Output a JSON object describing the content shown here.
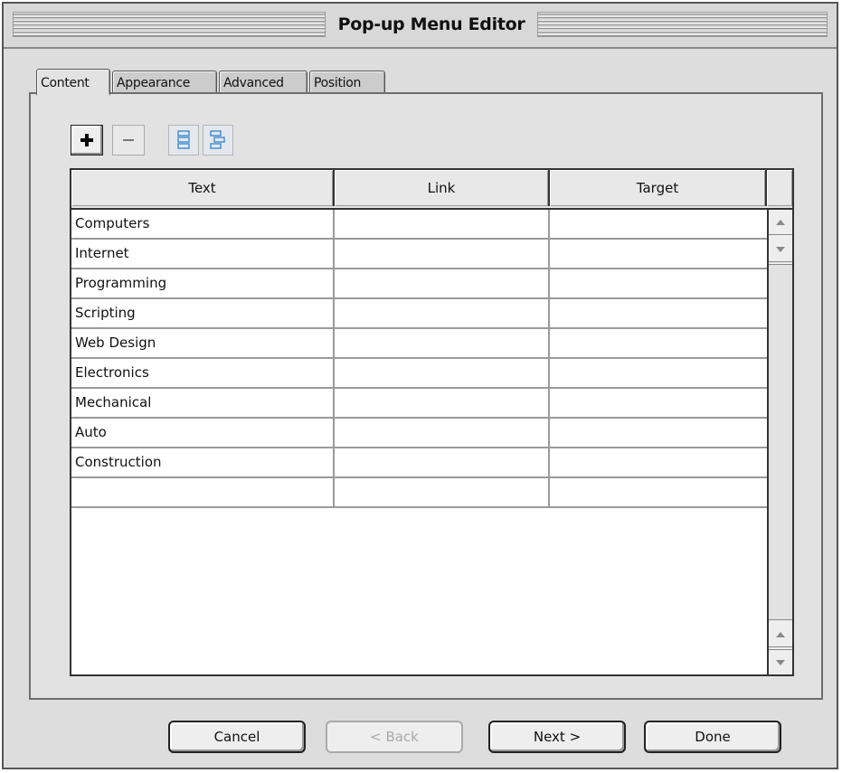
{
  "window": {
    "title": "Pop-up Menu Editor"
  },
  "tabs": [
    {
      "label": "Content",
      "active": true
    },
    {
      "label": "Appearance",
      "active": false
    },
    {
      "label": "Advanced",
      "active": false
    },
    {
      "label": "Position",
      "active": false
    }
  ],
  "toolbar": {
    "add_icon": "plus-icon",
    "remove_icon": "minus-icon",
    "move_up_icon": "move-up-icon",
    "move_down_icon": "move-down-icon"
  },
  "table": {
    "columns": [
      "Text",
      "Link",
      "Target"
    ],
    "rows": [
      [
        "Computers",
        "",
        ""
      ],
      [
        "Internet",
        "",
        ""
      ],
      [
        "Programming",
        "",
        ""
      ],
      [
        "Scripting",
        "",
        ""
      ],
      [
        "Web Design",
        "",
        ""
      ],
      [
        "Electronics",
        "",
        ""
      ],
      [
        "Mechanical",
        "",
        ""
      ],
      [
        "Auto",
        "",
        ""
      ],
      [
        "Construction",
        "",
        ""
      ],
      [
        "",
        "",
        ""
      ]
    ]
  },
  "buttons": {
    "cancel": "Cancel",
    "back": "< Back",
    "next": "Next >",
    "done": "Done"
  },
  "colors": {
    "window_bg": "#dddddd",
    "panel_bg": "#e2e2e2",
    "move_icon_blue": "#4a8fd0"
  }
}
